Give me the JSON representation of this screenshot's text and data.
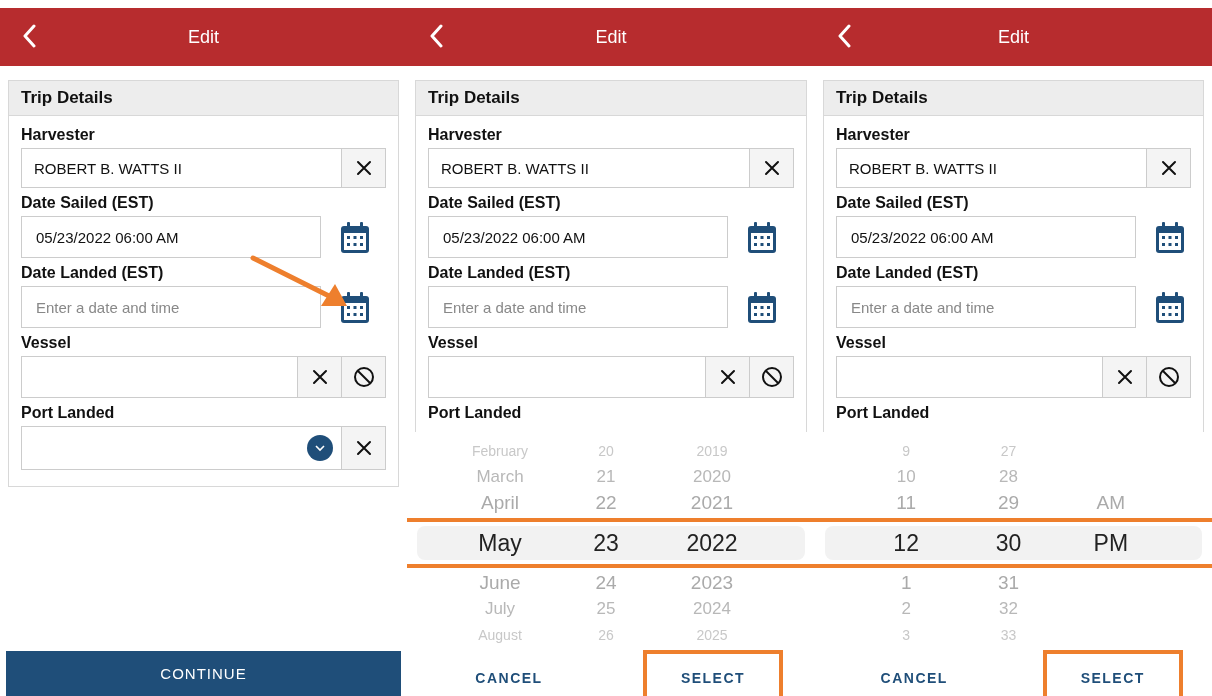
{
  "panels": [
    {
      "header": {
        "title": "Edit"
      },
      "section": {
        "title": "Trip Details",
        "fields": [
          {
            "kind": "clearable",
            "label": "Harvester",
            "value": "ROBERT B. WATTS II"
          },
          {
            "kind": "date",
            "label": "Date Sailed (EST)",
            "value": "05/23/2022 06:00 AM",
            "arrow": false
          },
          {
            "kind": "date",
            "label": "Date Landed (EST)",
            "placeholder": "Enter a date and time",
            "arrow": true
          },
          {
            "kind": "lookup",
            "label": "Vessel"
          },
          {
            "kind": "dropdown",
            "label": "Port Landed"
          }
        ]
      },
      "footer": {
        "kind": "continue",
        "buttons": [
          {
            "label": "CONTINUE",
            "highlighted": false
          }
        ]
      }
    },
    {
      "header": {
        "title": "Edit"
      },
      "section": {
        "title": "Trip Details",
        "fields": [
          {
            "kind": "clearable",
            "label": "Harvester",
            "value": "ROBERT B. WATTS II"
          },
          {
            "kind": "date",
            "label": "Date Sailed (EST)",
            "value": "05/23/2022 06:00 AM",
            "arrow": false
          },
          {
            "kind": "date",
            "label": "Date Landed (EST)",
            "placeholder": "Enter a date and time",
            "arrow": false
          },
          {
            "kind": "lookup",
            "label": "Vessel"
          },
          {
            "kind": "label_only",
            "label": "Port Landed"
          }
        ]
      },
      "picker": {
        "highlighted": true,
        "columns": [
          {
            "items": [
              {
                "text": "February",
                "selected": false
              },
              {
                "text": "March",
                "selected": false
              },
              {
                "text": "April",
                "selected": false
              },
              {
                "text": "May",
                "selected": true
              },
              {
                "text": "June",
                "selected": false
              },
              {
                "text": "July",
                "selected": false
              },
              {
                "text": "August",
                "selected": false
              }
            ]
          },
          {
            "items": [
              {
                "text": "20",
                "selected": false
              },
              {
                "text": "21",
                "selected": false
              },
              {
                "text": "22",
                "selected": false
              },
              {
                "text": "23",
                "selected": true
              },
              {
                "text": "24",
                "selected": false
              },
              {
                "text": "25",
                "selected": false
              },
              {
                "text": "26",
                "selected": false
              }
            ]
          },
          {
            "items": [
              {
                "text": "2019",
                "selected": false
              },
              {
                "text": "2020",
                "selected": false
              },
              {
                "text": "2021",
                "selected": false
              },
              {
                "text": "2022",
                "selected": true
              },
              {
                "text": "2023",
                "selected": false
              },
              {
                "text": "2024",
                "selected": false
              },
              {
                "text": "2025",
                "selected": false
              }
            ]
          }
        ]
      },
      "footer": {
        "kind": "dialog",
        "buttons": [
          {
            "label": "CANCEL",
            "highlighted": false
          },
          {
            "label": "SELECT",
            "highlighted": true
          }
        ]
      }
    },
    {
      "header": {
        "title": "Edit"
      },
      "section": {
        "title": "Trip Details",
        "fields": [
          {
            "kind": "clearable",
            "label": "Harvester",
            "value": "ROBERT B. WATTS II"
          },
          {
            "kind": "date",
            "label": "Date Sailed (EST)",
            "value": "05/23/2022 06:00 AM",
            "arrow": false
          },
          {
            "kind": "date",
            "label": "Date Landed (EST)",
            "placeholder": "Enter a date and time",
            "arrow": false
          },
          {
            "kind": "lookup",
            "label": "Vessel"
          },
          {
            "kind": "label_only",
            "label": "Port Landed"
          }
        ]
      },
      "picker": {
        "highlighted": true,
        "columns": [
          {
            "items": [
              {
                "text": "9",
                "selected": false
              },
              {
                "text": "10",
                "selected": false
              },
              {
                "text": "11",
                "selected": false
              },
              {
                "text": "12",
                "selected": true
              },
              {
                "text": "1",
                "selected": false
              },
              {
                "text": "2",
                "selected": false
              },
              {
                "text": "3",
                "selected": false
              }
            ]
          },
          {
            "items": [
              {
                "text": "27",
                "selected": false
              },
              {
                "text": "28",
                "selected": false
              },
              {
                "text": "29",
                "selected": false
              },
              {
                "text": "30",
                "selected": true
              },
              {
                "text": "31",
                "selected": false
              },
              {
                "text": "32",
                "selected": false
              },
              {
                "text": "33",
                "selected": false
              }
            ]
          },
          {
            "items": [
              {
                "text": "AM",
                "selected": false
              },
              {
                "text": "PM",
                "selected": true
              }
            ]
          }
        ]
      },
      "footer": {
        "kind": "dialog",
        "buttons": [
          {
            "label": "CANCEL",
            "highlighted": false
          },
          {
            "label": "SELECT",
            "highlighted": true
          }
        ]
      }
    }
  ]
}
